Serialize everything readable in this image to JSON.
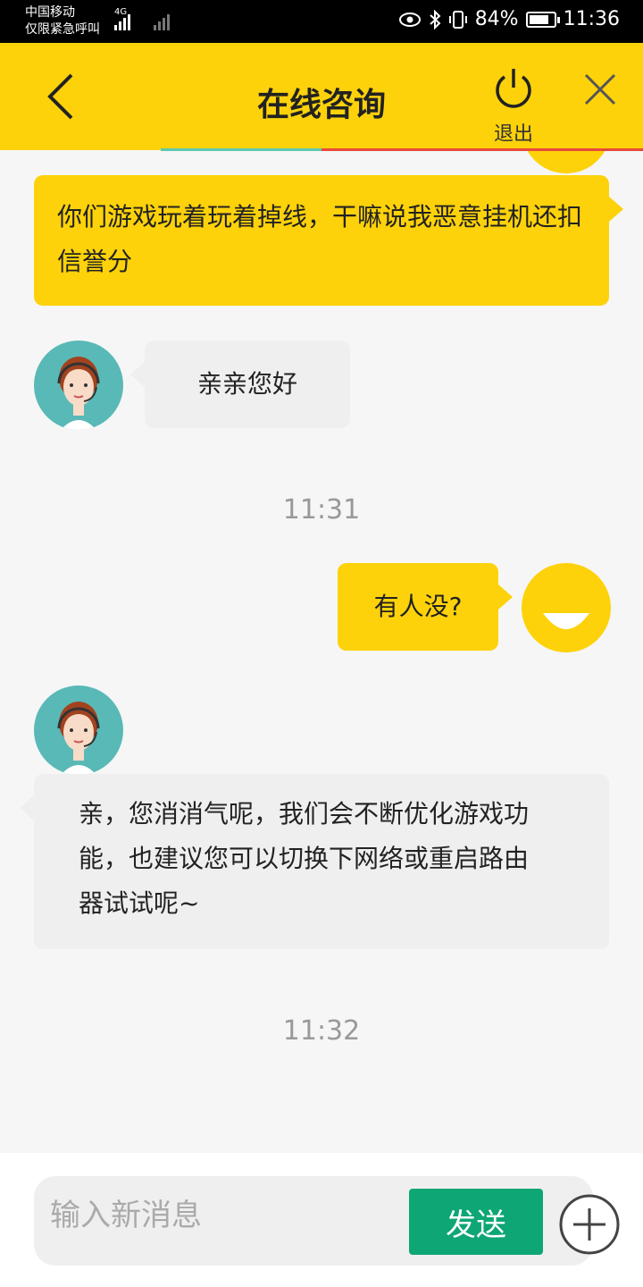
{
  "status_bar": {
    "carrier_line1": "中国移动",
    "carrier_line2": "仅限紧急呼叫",
    "network": "4G",
    "battery": "84%",
    "time": "11:36"
  },
  "header": {
    "title": "在线咨询",
    "logout_label": "退出"
  },
  "colors": {
    "brand_yellow": "#fdd20a",
    "send_green": "#0da674",
    "agent_avatar_bg": "#59b9b7"
  },
  "messages": [
    {
      "side": "user",
      "text": "你们游戏玩着玩着掉线，干嘛说我恶意挂机还扣信誉分"
    },
    {
      "side": "agent",
      "text": "亲亲您好"
    },
    {
      "side": "time",
      "text": "11:31"
    },
    {
      "side": "user",
      "text": "有人没?"
    },
    {
      "side": "agent",
      "text": "亲，您消消气呢，我们会不断优化游戏功能，也建议您可以切换下网络或重启路由器试试呢~"
    },
    {
      "side": "time",
      "text": "11:32"
    }
  ],
  "input": {
    "placeholder": "输入新消息",
    "value": "",
    "send_label": "发送"
  }
}
